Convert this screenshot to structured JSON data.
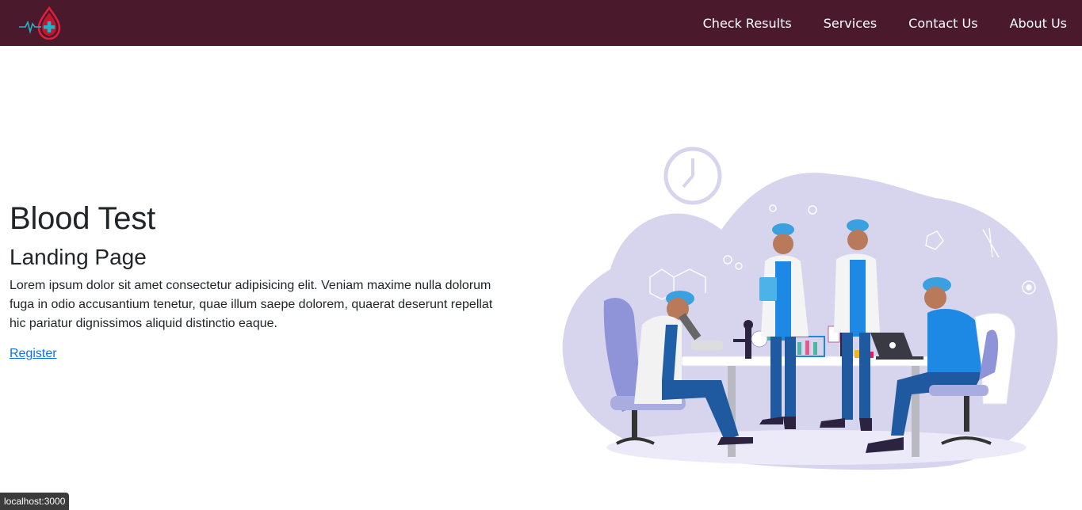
{
  "navbar": {
    "logo_icon": "blood-drop-heartbeat-cross-icon",
    "links": [
      "Check Results",
      "Services",
      "Contact Us",
      "About Us"
    ],
    "background_color": "#4a1a2c"
  },
  "hero": {
    "title": "Blood Test",
    "subtitle": "Landing Page",
    "description": "Lorem ipsum dolor sit amet consectetur adipisicing elit. Veniam maxime nulla dolorum fuga in odio accusantium tenetur, quae illum saepe dolorem, quaerat deserunt repellat hic pariatur dignissimos aliquid distinctio eaque.",
    "register_label": "Register"
  },
  "illustration": {
    "subject": "lab-scientists-illustration",
    "accent_color": "#1e88e5",
    "blob_color": "#d7d5ee"
  },
  "status_bar": {
    "url": "localhost:3000"
  }
}
